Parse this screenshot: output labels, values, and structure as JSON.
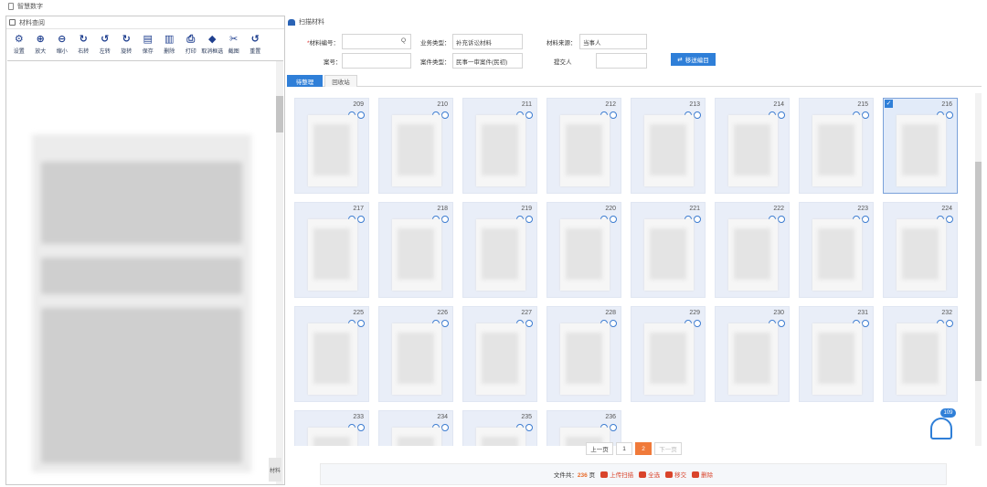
{
  "window": {
    "title": "智慧数字"
  },
  "left_panel": {
    "title": "材料查阅",
    "toolbar": [
      {
        "icon": "gear-icon",
        "glyph": "⚙",
        "label": "设置"
      },
      {
        "icon": "zoom-in-icon",
        "glyph": "⊕",
        "label": "放大"
      },
      {
        "icon": "zoom-out-icon",
        "glyph": "⊖",
        "label": "缩小"
      },
      {
        "icon": "rotate-right-icon",
        "glyph": "↻",
        "label": "右转"
      },
      {
        "icon": "rotate-left-icon",
        "glyph": "↺",
        "label": "左转"
      },
      {
        "icon": "rotate-icon",
        "glyph": "↻",
        "label": "旋转"
      },
      {
        "icon": "save-icon",
        "glyph": "▤",
        "label": "保存"
      },
      {
        "icon": "delete-icon",
        "glyph": "▥",
        "label": "删除"
      },
      {
        "icon": "print-icon",
        "glyph": "⎙",
        "label": "打印"
      },
      {
        "icon": "eraser-icon",
        "glyph": "◆",
        "label": "取消框选"
      },
      {
        "icon": "crop-icon",
        "glyph": "✂",
        "label": "截图"
      },
      {
        "icon": "reset-icon",
        "glyph": "↺",
        "label": "重置"
      }
    ],
    "side_tab": "材料"
  },
  "right_panel": {
    "title": "扫描材料",
    "form": {
      "material_no_label": "材料编号：",
      "material_no_value": "",
      "search_glyph": "Q",
      "business_type_label": "业务类型：",
      "business_type_value": "补充诉讼材料",
      "material_source_label": "材料来源：",
      "material_source_value": "当事人",
      "case_no_label": "案号：",
      "case_no_value": "",
      "case_type_label": "案件类型：",
      "case_type_value": "民事一审案件(民初)",
      "submitter_label": "提交人",
      "submitter_value": "",
      "button_label": "移送编目",
      "button_glyph": "⇄"
    },
    "tabs": [
      {
        "label": "待整理",
        "active": true
      },
      {
        "label": "回收站",
        "active": false
      }
    ],
    "cards": [
      {
        "num": "209"
      },
      {
        "num": "210"
      },
      {
        "num": "211"
      },
      {
        "num": "212"
      },
      {
        "num": "213"
      },
      {
        "num": "214"
      },
      {
        "num": "215"
      },
      {
        "num": "216",
        "selected": true
      },
      {
        "num": "217"
      },
      {
        "num": "218"
      },
      {
        "num": "219"
      },
      {
        "num": "220"
      },
      {
        "num": "221"
      },
      {
        "num": "222"
      },
      {
        "num": "223"
      },
      {
        "num": "224"
      },
      {
        "num": "225"
      },
      {
        "num": "226"
      },
      {
        "num": "227"
      },
      {
        "num": "228"
      },
      {
        "num": "229"
      },
      {
        "num": "230"
      },
      {
        "num": "231"
      },
      {
        "num": "232"
      },
      {
        "num": "233"
      },
      {
        "num": "234"
      },
      {
        "num": "235"
      },
      {
        "num": "236"
      }
    ],
    "badge_count": "109",
    "pager": {
      "prev": "上一页",
      "pages": [
        "1",
        "2"
      ],
      "current": "2",
      "next": "下一页"
    },
    "footer": {
      "count_label": "文件共：",
      "count_value": "236",
      "count_unit": "页",
      "actions": [
        "上传扫描",
        "全选",
        "移交",
        "删除"
      ]
    }
  }
}
